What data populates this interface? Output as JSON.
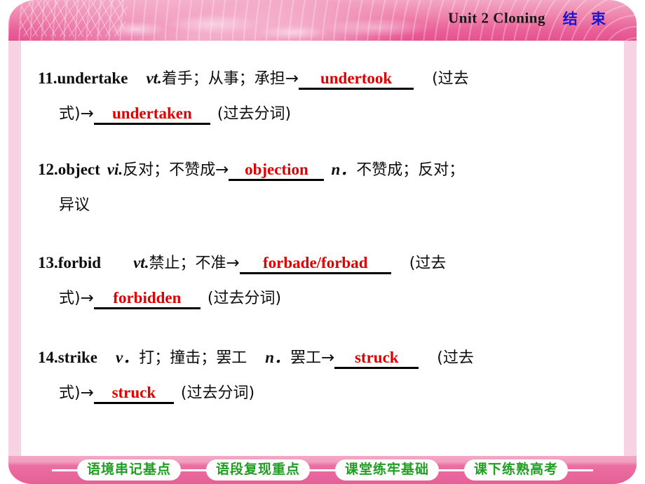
{
  "header": {
    "unit_title": "Unit 2  Cloning",
    "end_label": "结 束"
  },
  "entries": [
    {
      "number": "11.",
      "word": "undertake",
      "pos1": "vt.",
      "meaning1": "着手；从事；承担",
      "arrow": "→",
      "answer1": "undertook",
      "tense1": "(过去式)",
      "tense1_part_a": "(过去",
      "tense1_part_b": "式)",
      "answer2": "undertaken",
      "tense2": "(过去分词)"
    },
    {
      "number": "12.",
      "word": "object",
      "pos1": "vi.",
      "meaning1": "反对；不赞成",
      "arrow": "→",
      "answer1": "objection",
      "pos2": "n．",
      "meaning2": "不赞成；反对；",
      "meaning2_cont": "异议"
    },
    {
      "number": "13.",
      "word": "forbid",
      "pos1": "vt.",
      "meaning1": "禁止；不准",
      "arrow": "→",
      "answer1": "forbade/forbad",
      "tense1_part_a": "(过去",
      "tense1_part_b": "式)",
      "answer2": "forbidden",
      "tense2": "(过去分词)"
    },
    {
      "number": "14.",
      "word": "strike",
      "pos1": "v．",
      "meaning1": "打；撞击；罢工",
      "pos2": "n．",
      "meaning2": "罢工",
      "arrow": "→",
      "answer1": "struck",
      "tense1_part_a": "(过去",
      "tense1_part_b": "式)",
      "answer2": "struck",
      "tense2": "(过去分词)"
    }
  ],
  "footer": {
    "tabs": [
      {
        "label": "语境串记基点"
      },
      {
        "label": "语段复现重点"
      },
      {
        "label": "课堂练牢基础"
      },
      {
        "label": "课下练熟高考"
      }
    ]
  },
  "colors": {
    "answer_red": "#e00000",
    "header_pink": "#e9629a",
    "tab_green": "#1f9e22",
    "end_blue": "#1a14cf",
    "rail_pink": "#f7d2e3"
  }
}
